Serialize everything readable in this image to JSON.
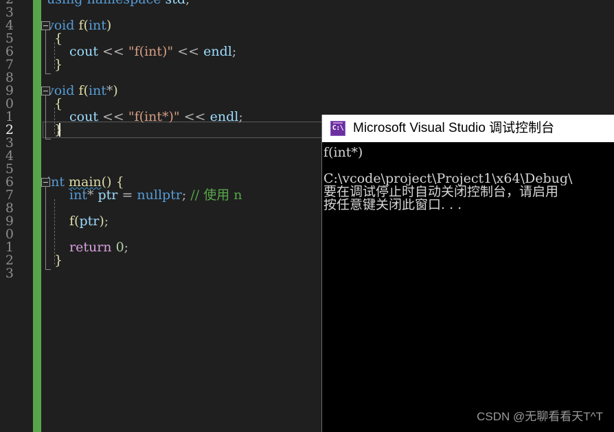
{
  "editor": {
    "language": "cpp",
    "colors": {
      "background": "#1f1f1f",
      "gutter_text": "#8d8d8d",
      "change_bar_green": "#57a64a",
      "keyword_blue": "#569cd6",
      "function_yellow": "#dcdcaa",
      "string_orange": "#d69d85",
      "variable_lightblue": "#9cdcfe",
      "comment_green": "#57a64a",
      "control_purple": "#d8a0df",
      "number_green": "#b5cea8"
    },
    "line_numbers": [
      "2",
      "3",
      "4",
      "5",
      "6",
      "7",
      "8",
      "9",
      "0",
      "1",
      "2",
      "3",
      "4",
      "5",
      "6",
      "7",
      "8",
      "9",
      "0",
      "1",
      "2",
      "3"
    ],
    "current_line_number": "2",
    "current_line_index": 10,
    "lines": [
      {
        "n": "2",
        "indent": 0,
        "tokens": [
          {
            "t": "using",
            "c": "kw"
          },
          {
            "t": " ",
            "c": "plain"
          },
          {
            "t": "namespace",
            "c": "kw"
          },
          {
            "t": " ",
            "c": "plain"
          },
          {
            "t": "std",
            "c": "var"
          },
          {
            "t": ";",
            "c": "op"
          }
        ]
      },
      {
        "n": "3",
        "indent": 0,
        "tokens": []
      },
      {
        "n": "4",
        "indent": 0,
        "tokens": [
          {
            "t": "void",
            "c": "kw"
          },
          {
            "t": " ",
            "c": "plain"
          },
          {
            "t": "f",
            "c": "fn"
          },
          {
            "t": "(",
            "c": "brace"
          },
          {
            "t": "int",
            "c": "kw"
          },
          {
            "t": ")",
            "c": "brace"
          }
        ]
      },
      {
        "n": "5",
        "indent": 1,
        "tokens": [
          {
            "t": "{",
            "c": "brace"
          }
        ]
      },
      {
        "n": "6",
        "indent": 2,
        "tokens": [
          {
            "t": "cout",
            "c": "var"
          },
          {
            "t": " ",
            "c": "plain"
          },
          {
            "t": "<<",
            "c": "op"
          },
          {
            "t": " ",
            "c": "plain"
          },
          {
            "t": "\"f(int)\"",
            "c": "str"
          },
          {
            "t": " ",
            "c": "plain"
          },
          {
            "t": "<<",
            "c": "op"
          },
          {
            "t": " ",
            "c": "plain"
          },
          {
            "t": "endl",
            "c": "var"
          },
          {
            "t": ";",
            "c": "op"
          }
        ]
      },
      {
        "n": "7",
        "indent": 1,
        "tokens": [
          {
            "t": "}",
            "c": "brace"
          }
        ]
      },
      {
        "n": "8",
        "indent": 0,
        "tokens": []
      },
      {
        "n": "9",
        "indent": 0,
        "tokens": [
          {
            "t": "void",
            "c": "kw"
          },
          {
            "t": " ",
            "c": "plain"
          },
          {
            "t": "f",
            "c": "fn"
          },
          {
            "t": "(",
            "c": "brace"
          },
          {
            "t": "int",
            "c": "kw"
          },
          {
            "t": "*",
            "c": "op"
          },
          {
            "t": ")",
            "c": "brace"
          }
        ]
      },
      {
        "n": "0",
        "indent": 1,
        "tokens": [
          {
            "t": "{",
            "c": "brace"
          }
        ]
      },
      {
        "n": "1",
        "indent": 2,
        "tokens": [
          {
            "t": "cout",
            "c": "var"
          },
          {
            "t": " ",
            "c": "plain"
          },
          {
            "t": "<<",
            "c": "op"
          },
          {
            "t": " ",
            "c": "plain"
          },
          {
            "t": "\"f(int*)\"",
            "c": "str"
          },
          {
            "t": " ",
            "c": "plain"
          },
          {
            "t": "<<",
            "c": "op"
          },
          {
            "t": " ",
            "c": "plain"
          },
          {
            "t": "endl",
            "c": "var"
          },
          {
            "t": ";",
            "c": "op"
          }
        ]
      },
      {
        "n": "2",
        "indent": 1,
        "tokens": [
          {
            "t": "}",
            "c": "brace"
          }
        ]
      },
      {
        "n": "3",
        "indent": 0,
        "tokens": []
      },
      {
        "n": "4",
        "indent": 0,
        "tokens": []
      },
      {
        "n": "5",
        "indent": 0,
        "tokens": []
      },
      {
        "n": "6",
        "indent": 0,
        "tokens": [
          {
            "t": "int",
            "c": "kw"
          },
          {
            "t": " ",
            "c": "plain"
          },
          {
            "t": "main",
            "c": "fn-squiggle"
          },
          {
            "t": "(",
            "c": "brace"
          },
          {
            "t": ")",
            "c": "brace"
          },
          {
            "t": " ",
            "c": "plain"
          },
          {
            "t": "{",
            "c": "brace"
          }
        ]
      },
      {
        "n": "7",
        "indent": 2,
        "tokens": [
          {
            "t": "int",
            "c": "kw"
          },
          {
            "t": "*",
            "c": "op"
          },
          {
            "t": " ",
            "c": "plain"
          },
          {
            "t": "ptr",
            "c": "var"
          },
          {
            "t": " ",
            "c": "plain"
          },
          {
            "t": "=",
            "c": "op"
          },
          {
            "t": " ",
            "c": "plain"
          },
          {
            "t": "nullptr",
            "c": "kw"
          },
          {
            "t": ";",
            "c": "op"
          },
          {
            "t": " ",
            "c": "plain"
          },
          {
            "t": "// 使用 n",
            "c": "cmt"
          }
        ]
      },
      {
        "n": "8",
        "indent": 0,
        "tokens": []
      },
      {
        "n": "9",
        "indent": 2,
        "tokens": [
          {
            "t": "f",
            "c": "fn"
          },
          {
            "t": "(",
            "c": "brace"
          },
          {
            "t": "ptr",
            "c": "var"
          },
          {
            "t": ")",
            "c": "brace"
          },
          {
            "t": ";",
            "c": "op"
          }
        ]
      },
      {
        "n": "0",
        "indent": 0,
        "tokens": []
      },
      {
        "n": "1",
        "indent": 2,
        "tokens": [
          {
            "t": "return",
            "c": "ctl"
          },
          {
            "t": " ",
            "c": "plain"
          },
          {
            "t": "0",
            "c": "num"
          },
          {
            "t": ";",
            "c": "op"
          }
        ]
      },
      {
        "n": "2",
        "indent": 1,
        "tokens": [
          {
            "t": "}",
            "c": "brace"
          }
        ]
      },
      {
        "n": "3",
        "indent": 0,
        "tokens": []
      }
    ],
    "full_text_lines": [
      "using namespace std;",
      "",
      "void f(int)",
      "{",
      "    cout << \"f(int)\" << endl;",
      "}",
      "",
      "void f(int*)",
      "{",
      "    cout << \"f(int*)\" << endl;",
      "}",
      "",
      "",
      "",
      "int main() {",
      "    int* ptr = nullptr; // 使用 n",
      "",
      "    f(ptr);",
      "",
      "    return 0;",
      "}",
      ""
    ],
    "fold_markers": [
      {
        "line_index": 2,
        "state": "expanded"
      },
      {
        "line_index": 7,
        "state": "expanded"
      },
      {
        "line_index": 14,
        "state": "expanded"
      }
    ]
  },
  "console": {
    "icon": "console-window-icon",
    "icon_glyph": "C:\\",
    "title": "Microsoft Visual Studio 调试控制台",
    "background": "#000000",
    "titlebar_background": "#ffffff",
    "output_lines": [
      "f(int*)",
      "",
      "C:\\vcode\\project\\Project1\\x64\\Debug\\",
      "要在调试停止时自动关闭控制台，请启用",
      "按任意键关闭此窗口. . ."
    ]
  },
  "watermark": {
    "text": "CSDN @无聊看看天T^T"
  }
}
